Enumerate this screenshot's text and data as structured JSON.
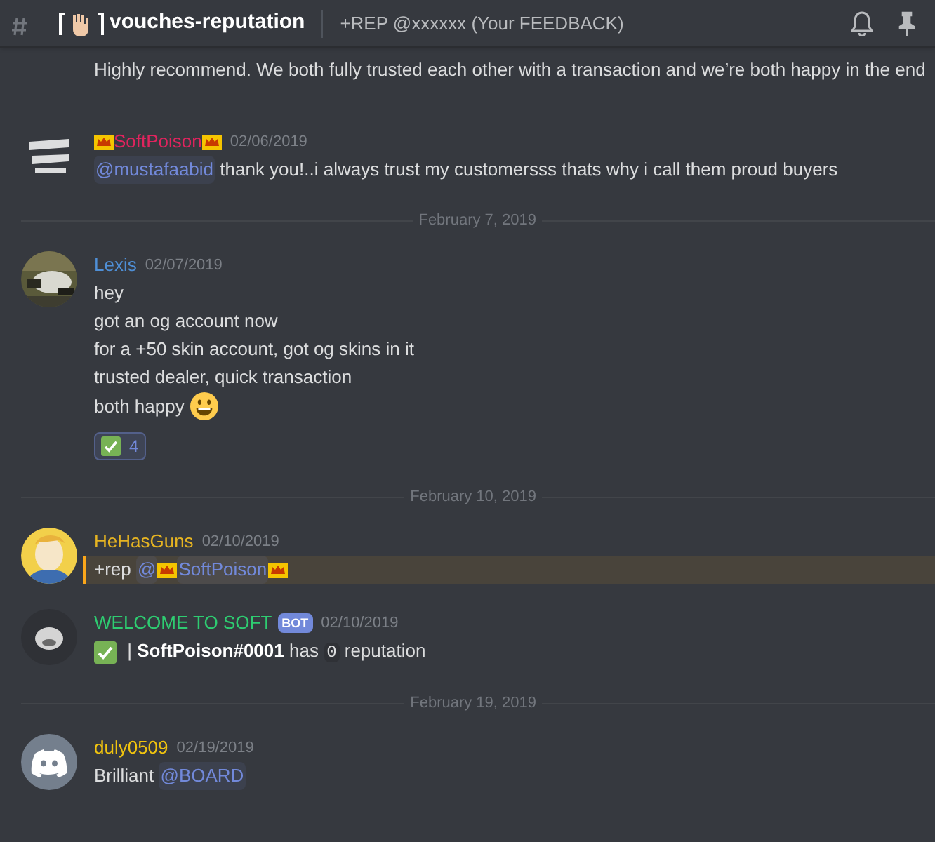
{
  "header": {
    "channel_name": "vouches-reputation",
    "topic": "+REP @xxxxxx (Your FEEDBACK)"
  },
  "items": [
    {
      "kind": "continuation",
      "lines": [
        [
          {
            "kind": "text",
            "text": "Highly recommend. We both fully trusted each other with a transaction and we’re both happy in the end"
          }
        ]
      ]
    },
    {
      "kind": "message",
      "avatar": {
        "kind": "logo"
      },
      "author": "SoftPoison",
      "color": "#e0245e",
      "crowned": true,
      "timestamp": "02/06/2019",
      "highlighted": false,
      "lines": [
        [
          {
            "kind": "mention",
            "text": "@mustafaabid"
          },
          {
            "kind": "text",
            "text": " thank you!..i always trust my customersss thats why i call them proud buyers"
          }
        ]
      ]
    },
    {
      "kind": "divider",
      "date": "February 7, 2019"
    },
    {
      "kind": "message",
      "avatar": {
        "kind": "picture"
      },
      "author": "Lexis",
      "color": "#4f8fd6",
      "crowned": false,
      "timestamp": "02/07/2019",
      "highlighted": false,
      "lines": [
        [
          {
            "kind": "text",
            "text": "hey"
          }
        ],
        [
          {
            "kind": "text",
            "text": "got an og account now"
          }
        ],
        [
          {
            "kind": "text",
            "text": "for a +50 skin account, got og skins in it"
          }
        ],
        [
          {
            "kind": "text",
            "text": "trusted dealer, quick transaction"
          }
        ],
        [
          {
            "kind": "text",
            "text": "both happy "
          },
          {
            "kind": "smiley"
          }
        ]
      ],
      "reaction": {
        "count": "4"
      }
    },
    {
      "kind": "divider",
      "date": "February 10, 2019"
    },
    {
      "kind": "message",
      "avatar": {
        "kind": "cartoon"
      },
      "author": "HeHasGuns",
      "color": "#e6b422",
      "crowned": false,
      "timestamp": "02/10/2019",
      "highlighted": true,
      "lines": [
        [
          {
            "kind": "text",
            "text": "+rep "
          },
          {
            "kind": "mention",
            "text": "@"
          },
          {
            "kind": "crown"
          },
          {
            "kind": "mention",
            "text": "SoftPoison"
          },
          {
            "kind": "crown"
          }
        ]
      ]
    },
    {
      "kind": "message",
      "avatar": {
        "kind": "bot"
      },
      "author": "WELCOME TO SOFT",
      "color": "#2ecc71",
      "crowned": false,
      "badge": "BOT",
      "timestamp": "02/10/2019",
      "highlighted": false,
      "lines": [
        [
          {
            "kind": "check"
          },
          {
            "kind": "text",
            "text": " | "
          },
          {
            "kind": "bold",
            "text": "SoftPoison#0001"
          },
          {
            "kind": "text",
            "text": " has "
          },
          {
            "kind": "code",
            "text": "0"
          },
          {
            "kind": "text",
            "text": " reputation"
          }
        ]
      ]
    },
    {
      "kind": "divider",
      "date": "February 19, 2019"
    },
    {
      "kind": "message",
      "avatar": {
        "kind": "default"
      },
      "author": "duly0509",
      "color": "#f1c40f",
      "crowned": false,
      "timestamp": "02/19/2019",
      "highlighted": false,
      "lines": [
        [
          {
            "kind": "text",
            "text": "Brilliant "
          },
          {
            "kind": "mention",
            "text": "@BOARD"
          }
        ]
      ]
    }
  ]
}
